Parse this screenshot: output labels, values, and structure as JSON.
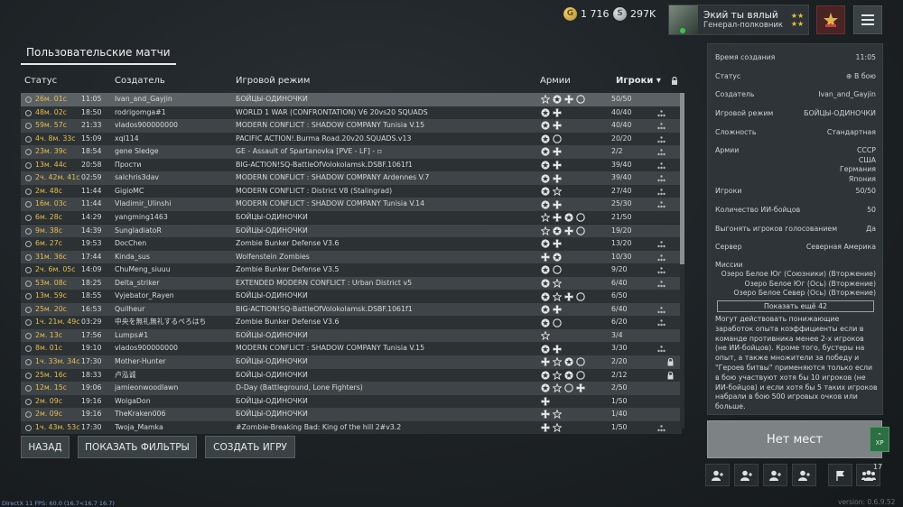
{
  "topbar": {
    "gold": "1 716",
    "silver": "297K",
    "nickname": "Экий ты вялый",
    "rank": "Генерал-полковник"
  },
  "tab_title": "Пользовательские матчи",
  "columns": {
    "status": "Статус",
    "creator": "Создатель",
    "mode": "Игровой режим",
    "armies": "Армии",
    "players": "Игроки"
  },
  "rows": [
    {
      "status": "26м. 01с",
      "time": "11:05",
      "creator": "Ivan_and_Gayjin",
      "mode": "БОЙЦЫ-ОДИНОЧКИ",
      "armies": [
        "star",
        "allies",
        "cross",
        "circle"
      ],
      "players": "50/50",
      "squad": false,
      "lock": false
    },
    {
      "status": "48м. 02с",
      "time": "18:50",
      "creator": "rodrigomga#1",
      "mode": "WORLD 1 WAR (CONFRONTATION) V6 20vs20 SQUADS",
      "armies": [
        "allies",
        "cross"
      ],
      "players": "40/40",
      "squad": true,
      "lock": false
    },
    {
      "status": "59м. 57с",
      "time": "21:33",
      "creator": "vlados900000000",
      "mode": "MODERN CONFLICT : SHADOW COMPANY Tunisia V.15",
      "armies": [
        "allies",
        "cross"
      ],
      "players": "40/40",
      "squad": true,
      "lock": false
    },
    {
      "status": "4ч. 8м. 33с",
      "time": "15:09",
      "creator": "xql114",
      "mode": "PACIFIC ACTION!.Burma Road.20v20.SQUADS.v13",
      "armies": [
        "allies",
        "circle"
      ],
      "players": "20/20",
      "squad": true,
      "lock": false
    },
    {
      "status": "23м. 39с",
      "time": "18:54",
      "creator": "gene Sledge",
      "mode": "GE - Assault of Spartanovka [PVE - LF] - ▫",
      "armies": [
        "allies",
        "cross"
      ],
      "players": "2/2",
      "squad": true,
      "lock": false
    },
    {
      "status": "13м. 44с",
      "time": "20:58",
      "creator": "Прости",
      "mode": "BIG-ACTION!SQ-BattleOfVolokolamsk.DSBF.1061f1",
      "armies": [
        "allies",
        "cross"
      ],
      "players": "39/40",
      "squad": true,
      "lock": false
    },
    {
      "status": "2ч. 42м. 41с",
      "time": "02:59",
      "creator": "salchris3dav",
      "mode": "MODERN CONFLICT : SHADOW COMPANY Ardennes V.7",
      "armies": [
        "allies",
        "cross"
      ],
      "players": "39/40",
      "squad": true,
      "lock": false
    },
    {
      "status": "2м. 48с",
      "time": "11:44",
      "creator": "GigioMC",
      "mode": "MODERN CONFLICT :  District V8 (Stalingrad)",
      "armies": [
        "allies",
        "star"
      ],
      "players": "27/40",
      "squad": true,
      "lock": false
    },
    {
      "status": "16м. 03с",
      "time": "11:44",
      "creator": "Vladimir_Ulinshi",
      "mode": "MODERN CONFLICT : SHADOW COMPANY Tunisia V.14",
      "armies": [
        "allies",
        "cross"
      ],
      "players": "25/30",
      "squad": true,
      "lock": false
    },
    {
      "status": "6м. 28с",
      "time": "14:29",
      "creator": "yangming1463",
      "mode": "БОЙЦЫ-ОДИНОЧКИ",
      "armies": [
        "star",
        "cross",
        "allies",
        "circle"
      ],
      "players": "21/50",
      "squad": false,
      "lock": false
    },
    {
      "status": "9м. 38с",
      "time": "14:39",
      "creator": "SungladiatoR",
      "mode": "БОЙЦЫ-ОДИНОЧКИ",
      "armies": [
        "star",
        "allies",
        "cross",
        "circle"
      ],
      "players": "19/20",
      "squad": false,
      "lock": false
    },
    {
      "status": "6м. 27с",
      "time": "19:53",
      "creator": "DocChen",
      "mode": "Zombie Bunker Defense V3.6",
      "armies": [
        "allies",
        "cross"
      ],
      "players": "13/20",
      "squad": true,
      "lock": false
    },
    {
      "status": "31м. 36с",
      "time": "17:44",
      "creator": "Kinda_sus",
      "mode": "Wolfenstein Zombies",
      "armies": [
        "cross",
        "allies"
      ],
      "players": "10/30",
      "squad": true,
      "lock": false
    },
    {
      "status": "2ч. 6м. 05с",
      "time": "14:09",
      "creator": "ChuMeng_siuuu",
      "mode": "Zombie Bunker Defense V3.5",
      "armies": [
        "allies",
        "circle"
      ],
      "players": "9/20",
      "squad": true,
      "lock": false
    },
    {
      "status": "53м. 08с",
      "time": "18:25",
      "creator": "Delta_striker",
      "mode": "EXTENDED MODERN CONFLICT : Urban District v5",
      "armies": [
        "allies",
        "star"
      ],
      "players": "6/40",
      "squad": true,
      "lock": false
    },
    {
      "status": "13м. 59с",
      "time": "18:55",
      "creator": "Vyjebator_Rayen",
      "mode": "БОЙЦЫ-ОДИНОЧКИ",
      "armies": [
        "allies",
        "star",
        "cross",
        "circle"
      ],
      "players": "6/50",
      "squad": false,
      "lock": false
    },
    {
      "status": "25м. 20с",
      "time": "16:53",
      "creator": "Quilheur",
      "mode": "BIG-ACTION!SQ-BattleOfVolokolamsk.DSBF.1061f1",
      "armies": [
        "allies",
        "cross"
      ],
      "players": "6/40",
      "squad": true,
      "lock": false
    },
    {
      "status": "1ч. 21м. 49с",
      "time": "03:29",
      "creator": "中央を無礼無礼するぺろはち",
      "mode": "Zombie Bunker Defense V3.6",
      "armies": [
        "allies",
        "circle"
      ],
      "players": "6/20",
      "squad": true,
      "lock": false
    },
    {
      "status": "2м. 13с",
      "time": "17:56",
      "creator": "Lumps#1",
      "mode": "БОЙЦЫ-ОДИНОЧКИ",
      "armies": [
        "star"
      ],
      "players": "3/4",
      "squad": false,
      "lock": false
    },
    {
      "status": "8м. 01с",
      "time": "19:10",
      "creator": "vlados900000000",
      "mode": "MODERN CONFLICT : SHADOW COMPANY Tunisia V.15",
      "armies": [
        "allies",
        "cross"
      ],
      "players": "3/30",
      "squad": true,
      "lock": false
    },
    {
      "status": "1ч. 33м. 34с",
      "time": "17:30",
      "creator": "Mother-Hunter",
      "mode": "БОЙЦЫ-ОДИНОЧКИ",
      "armies": [
        "cross",
        "star",
        "allies",
        "circle"
      ],
      "players": "2/20",
      "squad": false,
      "lock": true
    },
    {
      "status": "25м. 16с",
      "time": "18:33",
      "creator": "卢泓诚",
      "mode": "БОЙЦЫ-ОДИНОЧКИ",
      "armies": [
        "allies",
        "star",
        "allies",
        "circle"
      ],
      "players": "2/12",
      "squad": false,
      "lock": true
    },
    {
      "status": "12м. 15с",
      "time": "19:06",
      "creator": "jamieonwoodlawn",
      "mode": "D-Day (Battleground, Lone Fighters)",
      "armies": [
        "allies",
        "star",
        "circle",
        "cross"
      ],
      "players": "2/50",
      "squad": false,
      "lock": false
    },
    {
      "status": "2м. 09с",
      "time": "19:16",
      "creator": "WolgaDon",
      "mode": "БОЙЦЫ-ОДИНОЧКИ",
      "armies": [
        "cross"
      ],
      "players": "1/50",
      "squad": false,
      "lock": false
    },
    {
      "status": "2м. 09с",
      "time": "19:16",
      "creator": "TheKraken006",
      "mode": "БОЙЦЫ-ОДИНОЧКИ",
      "armies": [
        "cross",
        "star"
      ],
      "players": "1/40",
      "squad": false,
      "lock": false
    },
    {
      "status": "1ч. 43м. 53с",
      "time": "17:30",
      "creator": "Twoja_Mamka",
      "mode": "#Zombie-Breaking Bad: King of the hill 2#v3.2",
      "armies": [
        "cross",
        "star"
      ],
      "players": "1/50",
      "squad": true,
      "lock": false
    }
  ],
  "buttons": {
    "back": "НАЗАД",
    "show_filters": "ПОКАЗАТЬ ФИЛЬТРЫ",
    "create_game": "СОЗДАТЬ ИГРУ",
    "no_seats": "Нет мест",
    "show_more": "Показать ещё 42"
  },
  "details": {
    "created_label": "Время создания",
    "created_value": "11:05",
    "status_label": "Статус",
    "status_value": "В бою",
    "creator_label": "Создатель",
    "creator_value": "Ivan_and_Gayjin",
    "mode_label": "Игровой режим",
    "mode_value": "БОЙЦЫ-ОДИНОЧКИ",
    "difficulty_label": "Сложность",
    "difficulty_value": "Стандартная",
    "armies_label": "Армии",
    "armies_values": [
      "СССР",
      "США",
      "Германия",
      "Япония"
    ],
    "players_label": "Игроки",
    "players_value": "50/50",
    "bots_label": "Количество ИИ-бойцов",
    "bots_value": "50",
    "kick_label": "Выгонять игроков голосованием",
    "kick_value": "Да",
    "server_label": "Сервер",
    "server_value": "Северная Америка",
    "missions_label": "Миссии",
    "missions": [
      "Озеро Белое Юг (Союзники) (Вторжение)",
      "Озеро Белое Юг (Ось) (Вторжение)",
      "Озеро Белое Север (Ось) (Вторжение)"
    ],
    "info": "Могут действовать понижающие заработок опыта коэффициенты если в команде противника менее 2-х игроков (не ИИ-бойцов). Кроме того, бустеры на опыт, а также множители за победу и \"Героев битвы\" применяются только если в бою участвуют хотя бы 10 игроков (не ИИ-бойцов) и если хотя бы 5 таких игроков набрали в бою 500 игровых очков или больше."
  },
  "xp_label": "XP",
  "squad_count": "17",
  "fps": "DirectX 11 FPS: 60.0 (16.7<16.7 16.7)",
  "version": "version: 0.6.9.52",
  "colors": {
    "status_text": "#e6bf4e",
    "row_odd": "#3e4447",
    "row_even": "#2c3134",
    "row_selected": "#5b6164",
    "no_seats_bg": "#7d8284",
    "xp_badge": "#2d6f42"
  }
}
